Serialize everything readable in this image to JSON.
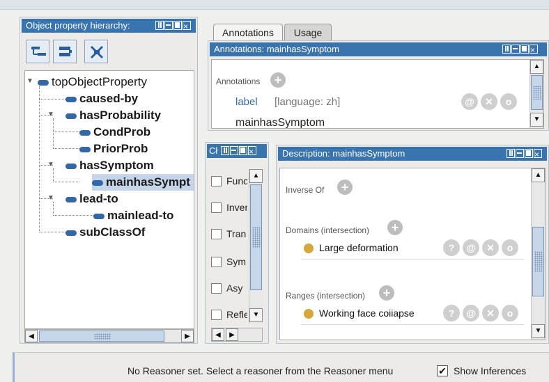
{
  "hierarchy_panel": {
    "title": "Object property hierarchy:",
    "toolbar": [
      "add-subproperty-icon",
      "add-sibling-icon",
      "delete-property-icon"
    ],
    "tree": {
      "root": "topObjectProperty",
      "caused_by": "caused-by",
      "hasProbability": "hasProbability",
      "condprob": "CondProb",
      "priorprob": "PriorProb",
      "hasSymptom": "hasSymptom",
      "mainhasSymptom": "mainhasSympt",
      "lead_to": "lead-to",
      "mainlead_to": "mainlead-to",
      "subClassOf": "subClassOf"
    }
  },
  "tabs": {
    "annotations": "Annotations",
    "usage": "Usage"
  },
  "annotations_panel": {
    "title": "Annotations: mainhasSymptom",
    "section_label": "Annotations",
    "label_key": "label",
    "label_lang": "[language: zh]",
    "label_value": "mainhasSymptom"
  },
  "characteristics_panel": {
    "title": "Cł",
    "items": [
      "Func",
      "Inver",
      "Tran",
      "Sym",
      "Asy",
      "Refle"
    ]
  },
  "description_panel": {
    "title": "Description: mainhasSymptom",
    "inverse_of": "Inverse Of",
    "domains": "Domains (intersection)",
    "domain_value": "Large deformation",
    "ranges": "Ranges (intersection)",
    "range_value": "Working face coiiapse"
  },
  "status_bar": {
    "message": "No Reasoner set. Select a reasoner from the Reasoner menu",
    "show_inferences": "Show Inferences",
    "show_inferences_checked": true
  },
  "colors": {
    "titlebar": "#3a74ae",
    "node": "#3467a6",
    "class_dot": "#d4a93a"
  }
}
